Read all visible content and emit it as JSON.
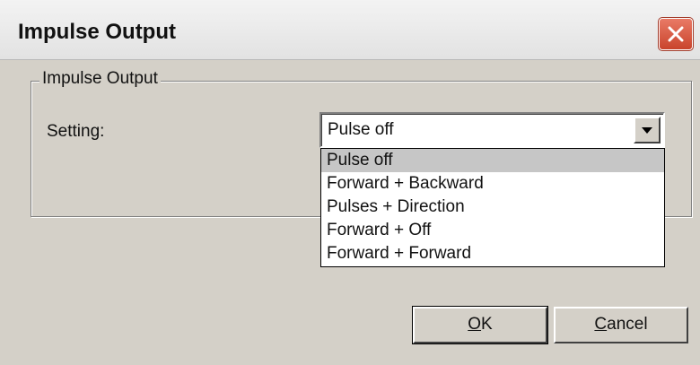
{
  "window": {
    "title": "Impulse Output",
    "close_icon": "close-icon"
  },
  "group": {
    "label": "Impulse Output",
    "setting_label": "Setting:",
    "selected_value": "Pulse off",
    "dropdown_icon": "chevron-down-icon",
    "options": [
      "Pulse off",
      "Forward + Backward",
      "Pulses + Direction",
      "Forward + Off",
      "Forward + Forward"
    ],
    "highlighted_option": "Pulse off"
  },
  "buttons": {
    "ok_label": "OK",
    "ok_mnemonic": "O",
    "cancel_label": "Cancel",
    "cancel_mnemonic": "C"
  },
  "colors": {
    "dialog_bg": "#d4d0c8",
    "close_button": "#c9442c",
    "highlight": "#c6c6c6"
  }
}
